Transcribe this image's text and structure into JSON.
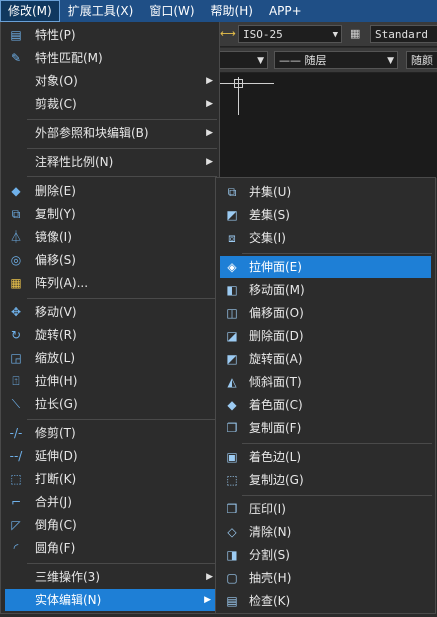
{
  "menubar": {
    "items": [
      {
        "label": "修改(M)"
      },
      {
        "label": "扩展工具(X)"
      },
      {
        "label": "窗口(W)"
      },
      {
        "label": "帮助(H)"
      },
      {
        "label": "APP+"
      }
    ]
  },
  "toolbar": {
    "dimstyle": "ISO-25",
    "textstyle": "Standard",
    "linetype": "—— 随层",
    "linetype2": "随颜"
  },
  "modify_menu": {
    "items": [
      {
        "label": "特性(P)",
        "icon": "properties-icon"
      },
      {
        "label": "特性匹配(M)",
        "icon": "match-properties-icon"
      },
      {
        "label": "对象(O)",
        "submenu": true
      },
      {
        "label": "剪裁(C)",
        "submenu": true
      },
      {
        "label": "外部参照和块编辑(B)",
        "submenu": true
      },
      {
        "label": "注释性比例(N)",
        "submenu": true
      },
      {
        "label": "删除(E)",
        "icon": "eraser-icon"
      },
      {
        "label": "复制(Y)",
        "icon": "copy-icon"
      },
      {
        "label": "镜像(I)",
        "icon": "mirror-icon"
      },
      {
        "label": "偏移(S)",
        "icon": "offset-icon"
      },
      {
        "label": "阵列(A)...",
        "icon": "array-icon"
      },
      {
        "label": "移动(V)",
        "icon": "move-icon"
      },
      {
        "label": "旋转(R)",
        "icon": "rotate-icon"
      },
      {
        "label": "缩放(L)",
        "icon": "scale-icon"
      },
      {
        "label": "拉伸(H)",
        "icon": "stretch-icon"
      },
      {
        "label": "拉长(G)",
        "icon": "lengthen-icon"
      },
      {
        "label": "修剪(T)",
        "icon": "trim-icon"
      },
      {
        "label": "延伸(D)",
        "icon": "extend-icon"
      },
      {
        "label": "打断(K)",
        "icon": "break-icon"
      },
      {
        "label": "合并(J)",
        "icon": "join-icon"
      },
      {
        "label": "倒角(C)",
        "icon": "chamfer-icon"
      },
      {
        "label": "圆角(F)",
        "icon": "fillet-icon"
      },
      {
        "label": "三维操作(3)",
        "submenu": true
      },
      {
        "label": "实体编辑(N)",
        "submenu": true,
        "selected": true
      }
    ]
  },
  "solid_edit_menu": {
    "items": [
      {
        "label": "并集(U)",
        "icon": "union-icon"
      },
      {
        "label": "差集(S)",
        "icon": "subtract-icon"
      },
      {
        "label": "交集(I)",
        "icon": "intersect-icon"
      },
      {
        "label": "拉伸面(E)",
        "icon": "extrude-faces-icon",
        "selected": true
      },
      {
        "label": "移动面(M)",
        "icon": "move-faces-icon"
      },
      {
        "label": "偏移面(O)",
        "icon": "offset-faces-icon"
      },
      {
        "label": "删除面(D)",
        "icon": "delete-faces-icon"
      },
      {
        "label": "旋转面(A)",
        "icon": "rotate-faces-icon"
      },
      {
        "label": "倾斜面(T)",
        "icon": "taper-faces-icon"
      },
      {
        "label": "着色面(C)",
        "icon": "color-faces-icon"
      },
      {
        "label": "复制面(F)",
        "icon": "copy-faces-icon"
      },
      {
        "label": "着色边(L)",
        "icon": "color-edges-icon"
      },
      {
        "label": "复制边(G)",
        "icon": "copy-edges-icon"
      },
      {
        "label": "压印(I)",
        "icon": "imprint-icon"
      },
      {
        "label": "清除(N)",
        "icon": "clean-icon"
      },
      {
        "label": "分割(S)",
        "icon": "separate-icon"
      },
      {
        "label": "抽壳(H)",
        "icon": "shell-icon"
      },
      {
        "label": "检查(K)",
        "icon": "check-icon"
      }
    ]
  },
  "colors": {
    "menubar": "#1f4f86",
    "menu_bg": "#2c2c2c",
    "highlight": "#1e7fd6"
  }
}
